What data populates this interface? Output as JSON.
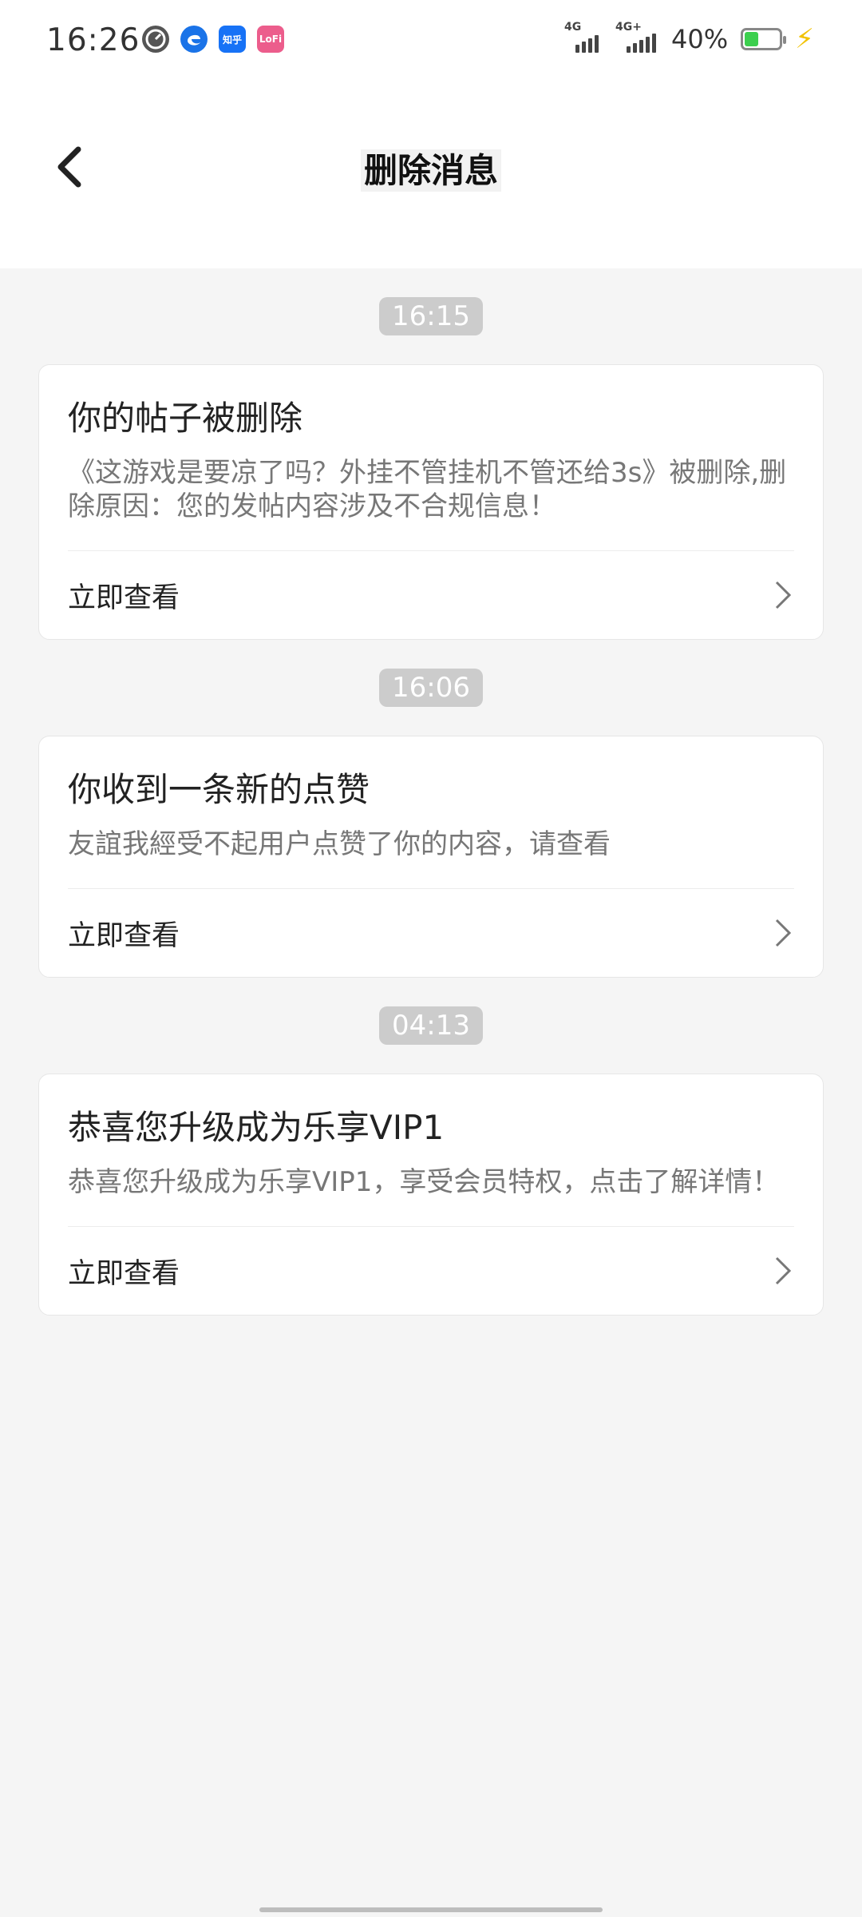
{
  "status_bar": {
    "time": "16:26",
    "apps": [
      {
        "name": "speed-icon",
        "label": ""
      },
      {
        "name": "edge-icon",
        "label": ""
      },
      {
        "name": "zhihu-icon",
        "label": "知乎"
      },
      {
        "name": "lofter-icon",
        "label": "LoFi"
      }
    ],
    "signal1_label": "4G",
    "signal2_label": "4G+",
    "battery_percent": "40%",
    "battery_level": 0.4,
    "battery_color": "#3ccf4e"
  },
  "header": {
    "title": "删除消息"
  },
  "messages": [
    {
      "time": "16:15",
      "title": "你的帖子被删除",
      "body": "《这游戏是要凉了吗？外挂不管挂机不管还给3s》被删除,删除原因：您的发帖内容涉及不合规信息！",
      "action": "立即查看"
    },
    {
      "time": "16:06",
      "title": "你收到一条新的点赞",
      "body": "友誼我經受不起用户点赞了你的内容，请查看",
      "action": "立即查看"
    },
    {
      "time": "04:13",
      "title": "恭喜您升级成为乐享VIP1",
      "body": "恭喜您升级成为乐享VIP1，享受会员特权，点击了解详情！",
      "action": "立即查看"
    }
  ]
}
